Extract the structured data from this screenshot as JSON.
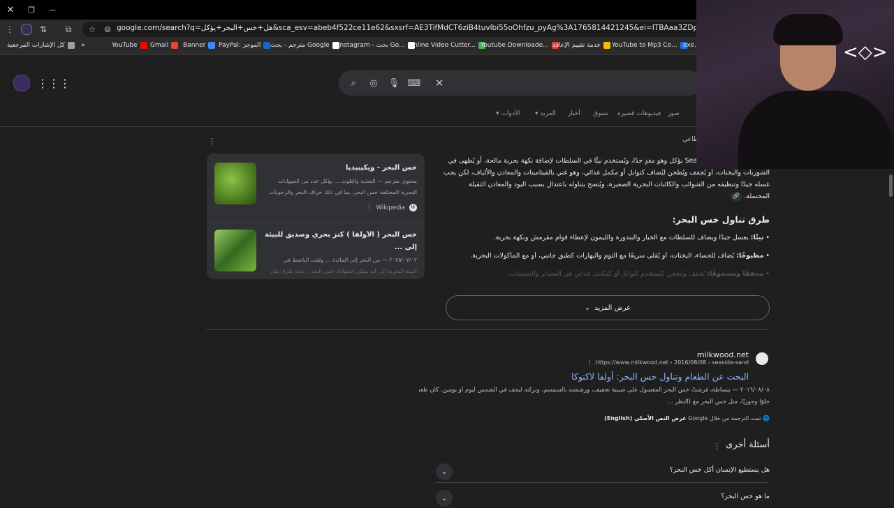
{
  "titlebar": {
    "close": "✕",
    "restore": "❐",
    "minimize": "—"
  },
  "toolbar": {
    "url": "google.com/search?q=هل+خس+البحر+يؤكل&sca_esv=abeb4f522ce11e62&sxsrf=AE3TifMdCT6ziB4tuvlbi55oOhfzu_pyAg%3A1765814421245&ei=ITBAaa3ZDpm7i-gPjvvqSQ&oq=هل+خس+البحر+ي&gs_l"
  },
  "bookmarks": [
    {
      "label": "كل الإشارات المرجعية",
      "color": "#9aa0a6"
    },
    {
      "label": "»",
      "color": ""
    },
    {
      "label": "YouTube",
      "color": "#ff0000"
    },
    {
      "label": "Gmail",
      "color": "#ea4335"
    },
    {
      "label": "Banner",
      "color": "#4285f4"
    },
    {
      "label": "PayPal: الموجز",
      "color": "#1e63c4"
    },
    {
      "label": "مترجم - بحث Google",
      "color": "#ffffff"
    },
    {
      "label": "instagram - بحث Go...",
      "color": "#ffffff"
    },
    {
      "label": "Online Video Cutter...",
      "color": "#4caf50"
    },
    {
      "label": "Youtube Downloade...",
      "color": "#e53935"
    },
    {
      "label": "خدمة تقييم الإعاقة",
      "color": "#fbbc04"
    },
    {
      "label": "YouTube to Mp3 Co...",
      "color": "#1a73e8"
    },
    {
      "label": "exe.io",
      "color": "#888"
    }
  ],
  "search": {
    "tabs": [
      "صور",
      "فيديوهات قصيرة",
      "تسوق",
      "أخبار",
      "المزيد",
      "الأدوات"
    ]
  },
  "overview": {
    "header_partial": "طاعي",
    "para_line1": "(Sea يؤكل وهو مغذٍ جدًا، ويُستخدم نيئًا في السلطات لإضافة نكهة بحرية مالحة، أو يُطهى في",
    "para_line2": "الشوربات واليخنات، أو يُجفف ويُطحن ليُضاف كتوابل أو مكمل غذائي، وهو غني بالفيتامينات والمعادن والألياف، لكن يجب",
    "para_line3": "غسله جيدًا وتنظيفه من الشوائب والكائنات البحرية الصغيرة، ويُنصح بتناوله باعتدال بسبب اليود والمعادن الثقيلة",
    "para_line4": "المحتملة.",
    "ways_heading": "طرق تناول خس البحر:",
    "bullets": [
      {
        "bold": "نيئًا:",
        "text": " يغسل جيدًا ويضاف للسلطات مع الخيار والبندورة والليمون لإعطاء قوام مقرمش ونكهة بحرية."
      },
      {
        "bold": "مطبوخًا:",
        "text": " يُضاف للحساء، اليخنات، أو يُقلى سريعًا مع الثوم والبهارات كطبق جانبي، أو مع المأكولات البحرية."
      },
      {
        "bold": "مجففًا ومسحوقًا:",
        "text": " يُجفف ويُطحن ليُستخدم كتوابل أو كمكمل غذائي في العصائر والصلصات."
      }
    ],
    "show_more": "عرض المزيد"
  },
  "sources": [
    {
      "title": "خس البحر - ويكيبيديا",
      "snippet1": "محتوى مترجم — التغذية والتلوث ... يؤكل عدد من الحيوانات",
      "snippet2": "البحرية المختلفة خس البحر، بما في ذلك خراف البحر والرخويات",
      "site": "Wikipedia"
    },
    {
      "title": "خس البحر ( الأولفا ) كنز بحري وصديق للبيئة .. من البحر",
      "title2": "إلى ...",
      "snippet1": "٢٠٢٥/٠٧/٠٢ — من البحر إلى المائدة ... ولفت الناشط في",
      "snippet2": "البيئة البحرية إلى أنه يمكن استهلاك خس البحر ، بعدة طرق مثل"
    }
  ],
  "result": {
    "site_name": "milkwood.net",
    "breadcrumb": "https://www.milkwood.net › 2016/08/08 › seaside-sand...",
    "title": "البحث عن الطعام وتناول خس البحر: أولفا لاكتوكا",
    "snippet1": "٢٠١٦/٠٨/٠٨ — ببساطة، فرشتُ خس البحر المغسول على صينية تجفيف، ورششته بالسمسم، وتركته ليجف في الشمس ليوم أو يومين. كان طعمه",
    "snippet2": "حلوًا وجوزيًا، مثل خس البحر مع (النظر ...",
    "translated_note": "تمت الترجمة من خلال Google",
    "show_original": "عرض النص الأصلي (English)"
  },
  "paa": {
    "heading": "أسئلة أخرى",
    "questions": [
      "هل يستطيع الإنسان أكل خس البحر؟",
      "ما هو خس البحر؟"
    ]
  }
}
